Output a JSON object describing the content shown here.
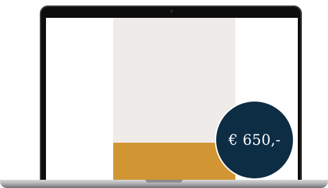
{
  "badge": {
    "price": "€ 650,-"
  },
  "colors": {
    "laptop_frame": "#0d0d0d",
    "screen_background": "#ffffff",
    "product_card": "#efebe8",
    "product_band": "#d19533",
    "badge_background": "#0d2d45",
    "badge_text": "#ffffff"
  }
}
